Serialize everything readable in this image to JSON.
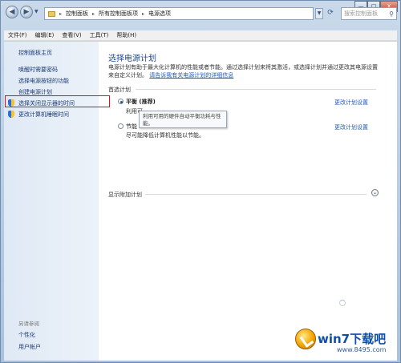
{
  "window": {
    "breadcrumbs": [
      "控制面板",
      "所有控制面板项",
      "电源选项"
    ],
    "search_placeholder": "搜索控制面板",
    "buttons": {
      "minimize": "—",
      "maximize": "□",
      "close": "X"
    }
  },
  "menu": [
    "文件(F)",
    "编辑(E)",
    "查看(V)",
    "工具(T)",
    "帮助(H)"
  ],
  "sidebar": {
    "home": "控制面板主页",
    "tasks": [
      "唤醒时需要密码",
      "选择电源按钮的功能",
      "创建电源计划",
      "选择关闭显示器的时间",
      "更改计算机睡眠时间"
    ],
    "see_also_title": "另请参阅",
    "see_also": [
      "个性化",
      "用户帐户"
    ]
  },
  "main": {
    "title": "选择电源计划",
    "description": "电源计划有助于最大化计算机的性能或者节能。通过选择计划来将其激活，或选择计划并通过更改其电源设置来自定义计划。",
    "description_link": "请告诉我有关电源计划的详细信息",
    "group_label": "首选计划",
    "plans": [
      {
        "name": "平衡 (推荐)",
        "desc": "利用可",
        "selected": true,
        "change": "更改计划设置"
      },
      {
        "name": "节能",
        "desc": "尽可能降低计算机性能以节能。",
        "selected": false,
        "change": "更改计划设置"
      }
    ],
    "tooltip": "利用可用的硬件自动平衡功耗与性能。",
    "show_more": "显示附加计划"
  },
  "watermark": {
    "main": "win7下载吧",
    "url": "www.8495.com"
  },
  "colors": {
    "accent": "#1f5bb8",
    "highlight_box": "#e0101a",
    "title_blue": "#1f4a8c"
  }
}
